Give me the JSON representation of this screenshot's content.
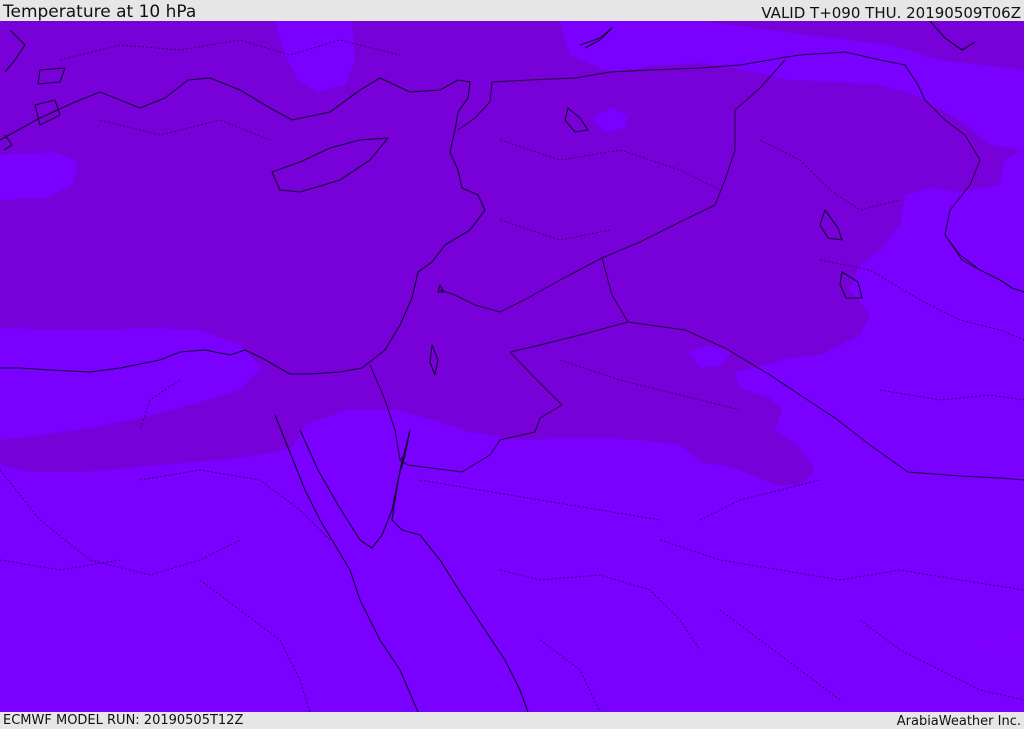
{
  "header": {
    "title": "Temperature at 10 hPa",
    "valid_time": "VALID T+090 THU. 20190509T06Z"
  },
  "footer": {
    "model_run": "ECMWF MODEL RUN: 20190505T12Z",
    "credit": "ArabiaWeather Inc."
  },
  "map": {
    "colors": {
      "field_warm": "#7800d8",
      "field_cool": "#7a00ff",
      "coastline": "#140030",
      "border": "#22003a"
    }
  }
}
